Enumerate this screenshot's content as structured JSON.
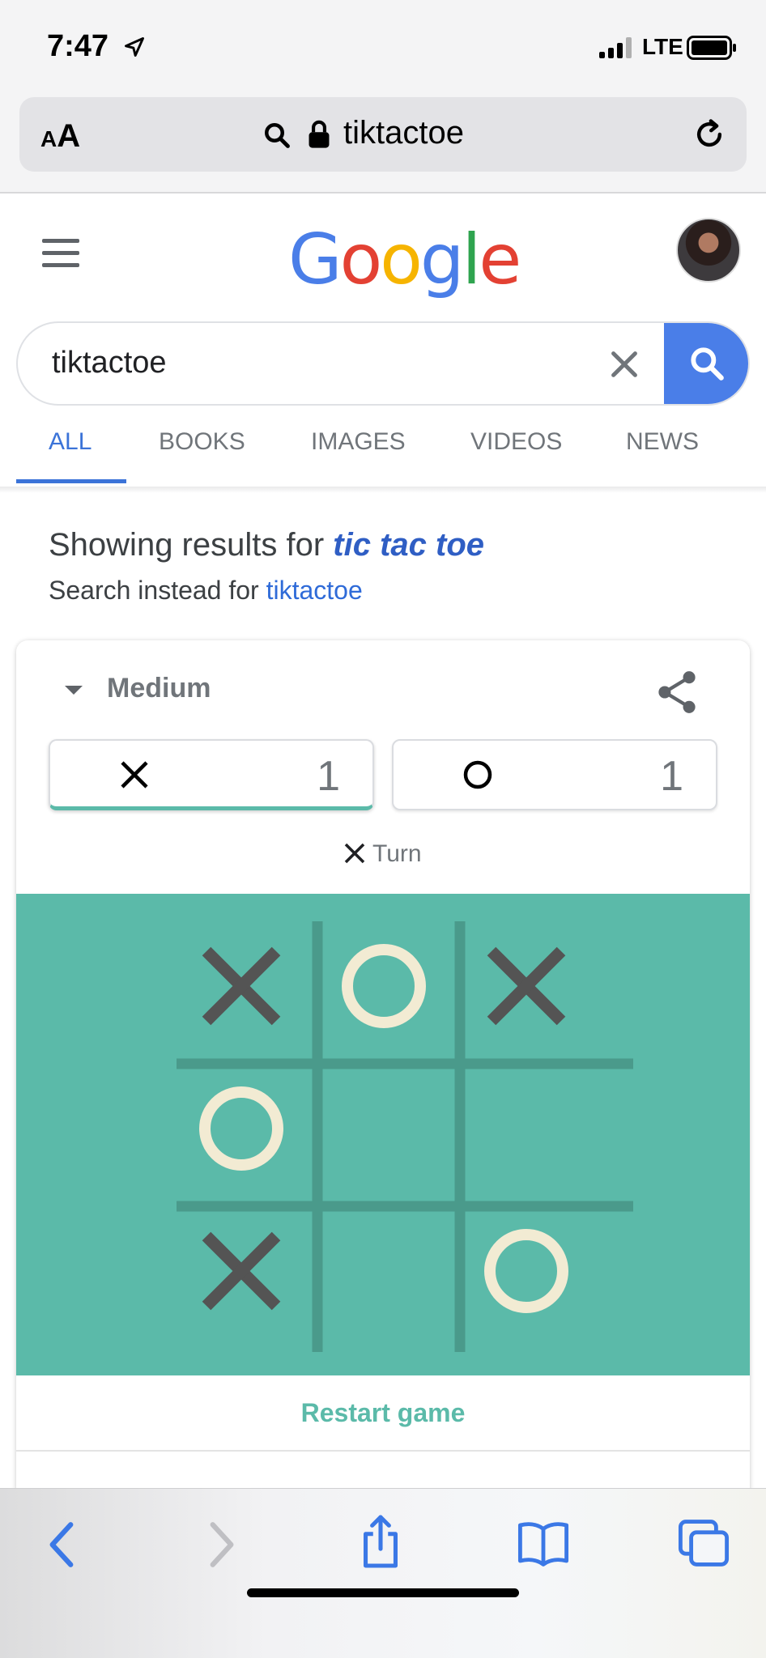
{
  "status_bar": {
    "time": "7:47",
    "network": "LTE"
  },
  "url_bar": {
    "text_size_label_small": "A",
    "text_size_label_large": "A",
    "url": "tiktactoe"
  },
  "google": {
    "logo_letters": [
      {
        "ch": "G",
        "color": "#4a7ee8"
      },
      {
        "ch": "o",
        "color": "#e34133"
      },
      {
        "ch": "o",
        "color": "#f6b400"
      },
      {
        "ch": "g",
        "color": "#4a7ee8"
      },
      {
        "ch": "l",
        "color": "#2fa44f"
      },
      {
        "ch": "e",
        "color": "#e34133"
      }
    ]
  },
  "search": {
    "query": "tiktactoe"
  },
  "tabs": [
    {
      "label": "ALL",
      "active": true
    },
    {
      "label": "BOOKS",
      "active": false
    },
    {
      "label": "IMAGES",
      "active": false
    },
    {
      "label": "VIDEOS",
      "active": false
    },
    {
      "label": "NEWS",
      "active": false
    }
  ],
  "correction": {
    "prefix": "Showing results for ",
    "corrected": "tic tac toe",
    "instead_prefix": "Search instead for ",
    "instead_link": "tiktactoe"
  },
  "game": {
    "difficulty": "Medium",
    "score_x": "1",
    "score_o": "1",
    "turn_label": "Turn",
    "turn_player": "X",
    "board": [
      "X",
      "O",
      "X",
      "O",
      "",
      "",
      "X",
      "",
      "O"
    ],
    "restart_label": "Restart game",
    "colors": {
      "board": "#5bbaa9",
      "grid": "#4a9a8b",
      "x_mark": "#545454",
      "o_mark": "#f2ebd3"
    }
  }
}
